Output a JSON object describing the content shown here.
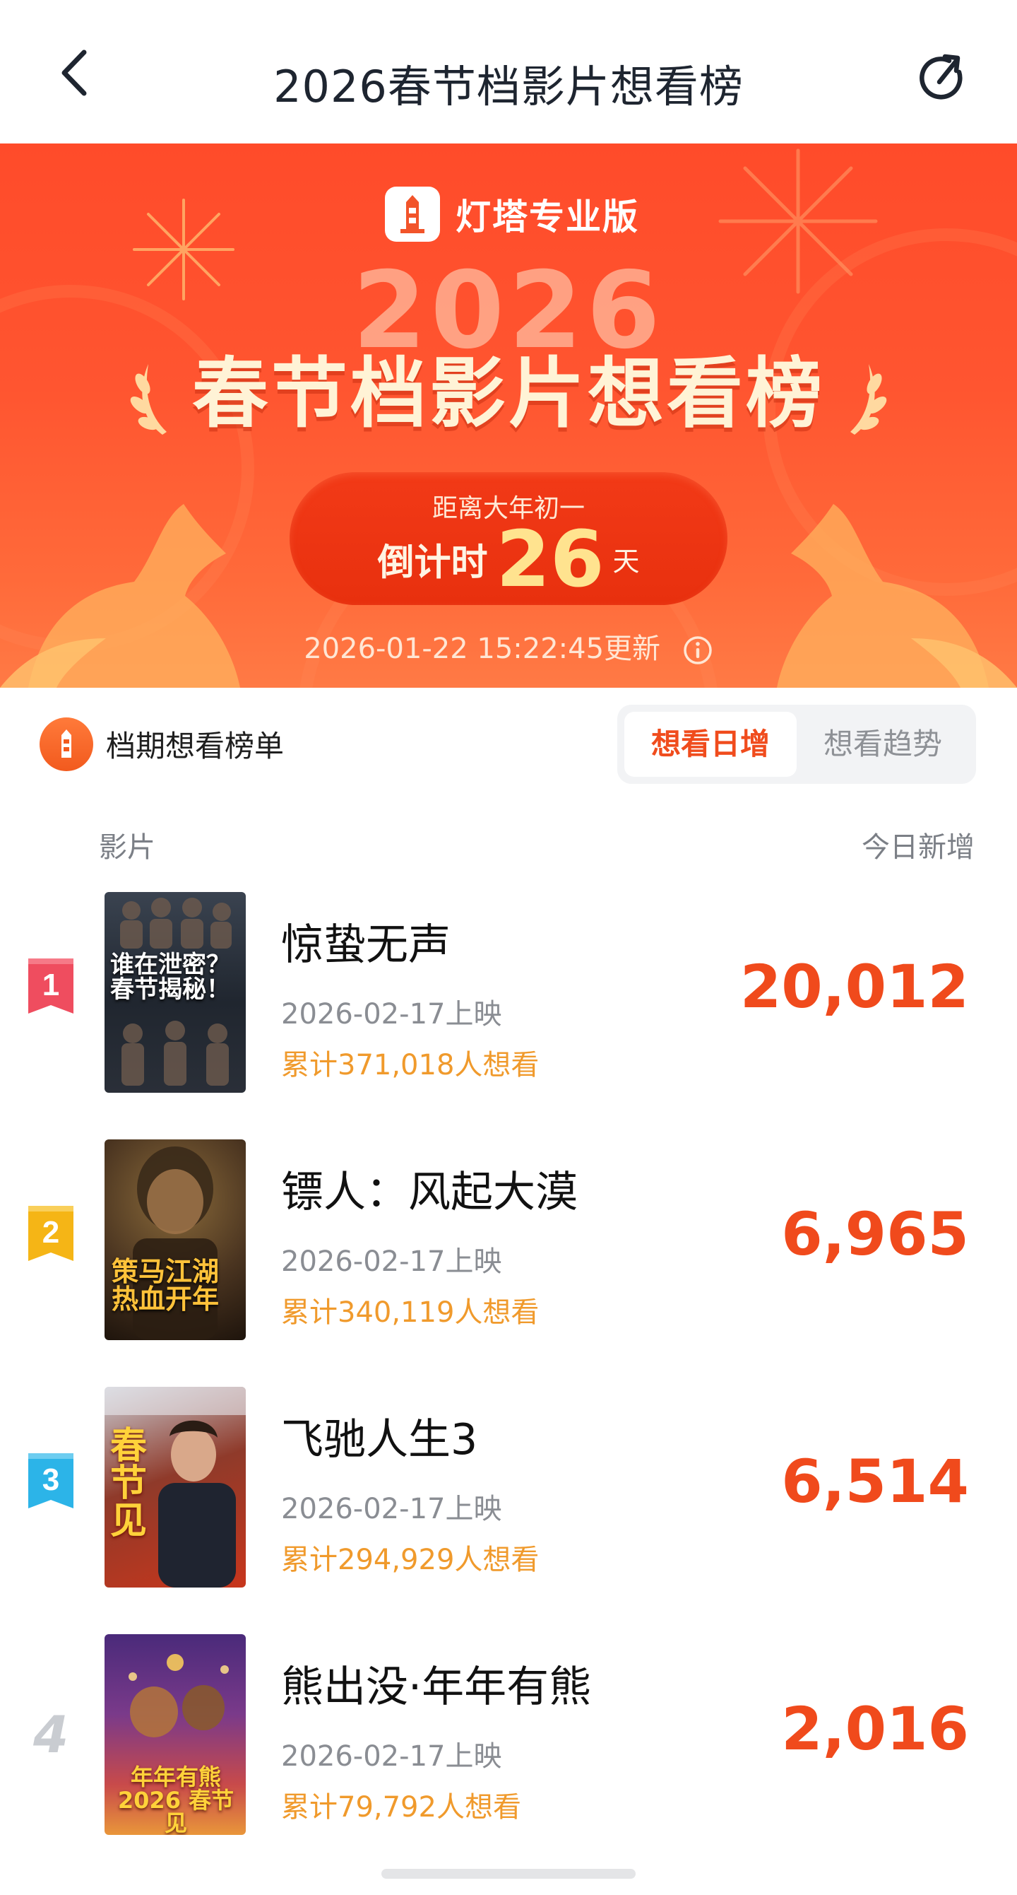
{
  "nav": {
    "title": "2026春节档影片想看榜",
    "back_icon": "back-chevron-icon",
    "share_icon": "share-refresh-icon"
  },
  "banner": {
    "brand_name": "灯塔专业版",
    "year": "2026",
    "title": "春节档影片想看榜",
    "countdown_label": "距离大年初一",
    "countdown_prefix": "倒计时",
    "countdown_days": "26",
    "countdown_unit": "天",
    "update_text": "2026-01-22 15:22:45更新",
    "colors": {
      "primary": "#ff4b2a",
      "accent": "#ffe38f"
    }
  },
  "section": {
    "title": "档期想看榜单",
    "tabs": [
      {
        "label": "想看日增",
        "active": true
      },
      {
        "label": "想看趋势",
        "active": false
      }
    ],
    "col_film": "影片",
    "col_today": "今日新增"
  },
  "films": [
    {
      "rank": "1",
      "title": "惊蛰无声",
      "release": "2026-02-17上映",
      "total": "累计371,018人想看",
      "today": "20,012",
      "poster_text": "谁在泄密？春节揭秘！",
      "badge_color": "#ef4d5f"
    },
    {
      "rank": "2",
      "title": "镖人：风起大漠",
      "release": "2026-02-17上映",
      "total": "累计340,119人想看",
      "today": "6,965",
      "poster_text": "策马江湖 热血开年",
      "badge_color": "#f5b516"
    },
    {
      "rank": "3",
      "title": "飞驰人生3",
      "release": "2026-02-17上映",
      "total": "累计294,929人想看",
      "today": "6,514",
      "poster_text": "春节见",
      "badge_color": "#2cb4e8"
    },
    {
      "rank": "4",
      "title": "熊出没·年年有熊",
      "release": "2026-02-17上映",
      "total": "累计79,792人想看",
      "today": "2,016",
      "poster_text": "年年有熊 2026 春节见",
      "badge_color": "#c9ccd1"
    }
  ]
}
